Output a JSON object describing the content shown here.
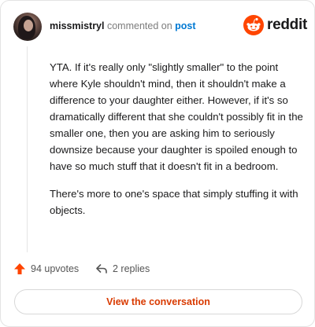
{
  "header": {
    "username": "missmistryl",
    "commented_on": "commented on",
    "post_link": "post",
    "brand": "reddit",
    "brand_color": "#FF4500"
  },
  "comment": {
    "paragraphs": [
      "YTA. If it's really only \"slightly smaller\" to the point where Kyle shouldn't mind, then it shouldn't make a difference to your daughter either. However, if it's so dramatically different that she couldn't possibly fit in the smaller one, then you are asking him to seriously downsize because your daughter is spoiled enough to have so much stuff that it doesn't fit in a bedroom.",
      "There's more to one's space that simply stuffing it with objects."
    ]
  },
  "actions": {
    "upvotes": "94 upvotes",
    "replies": "2 replies"
  },
  "cta": {
    "label": "View the conversation",
    "color": "#D93A00"
  }
}
